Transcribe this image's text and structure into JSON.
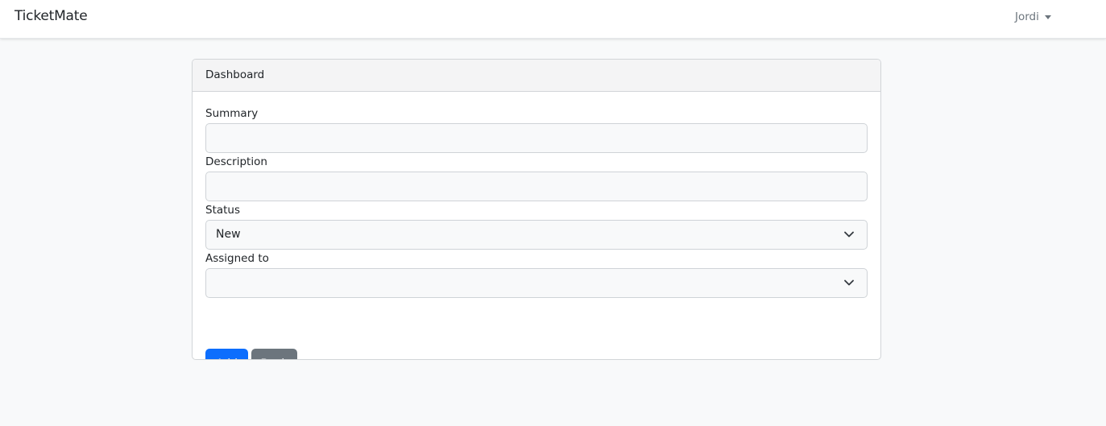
{
  "navbar": {
    "brand": "TicketMate",
    "user": "Jordi"
  },
  "card": {
    "header": "Dashboard"
  },
  "form": {
    "summary_label": "Summary",
    "summary_value": "",
    "description_label": "Description",
    "description_value": "",
    "status_label": "Status",
    "status_value": "New",
    "assigned_label": "Assigned to",
    "assigned_value": ""
  },
  "buttons": {
    "add": "Add",
    "back": "Back"
  },
  "colors": {
    "primary": "#0d6efd",
    "secondary": "#6c757d",
    "page_bg": "#f8f9fa"
  }
}
